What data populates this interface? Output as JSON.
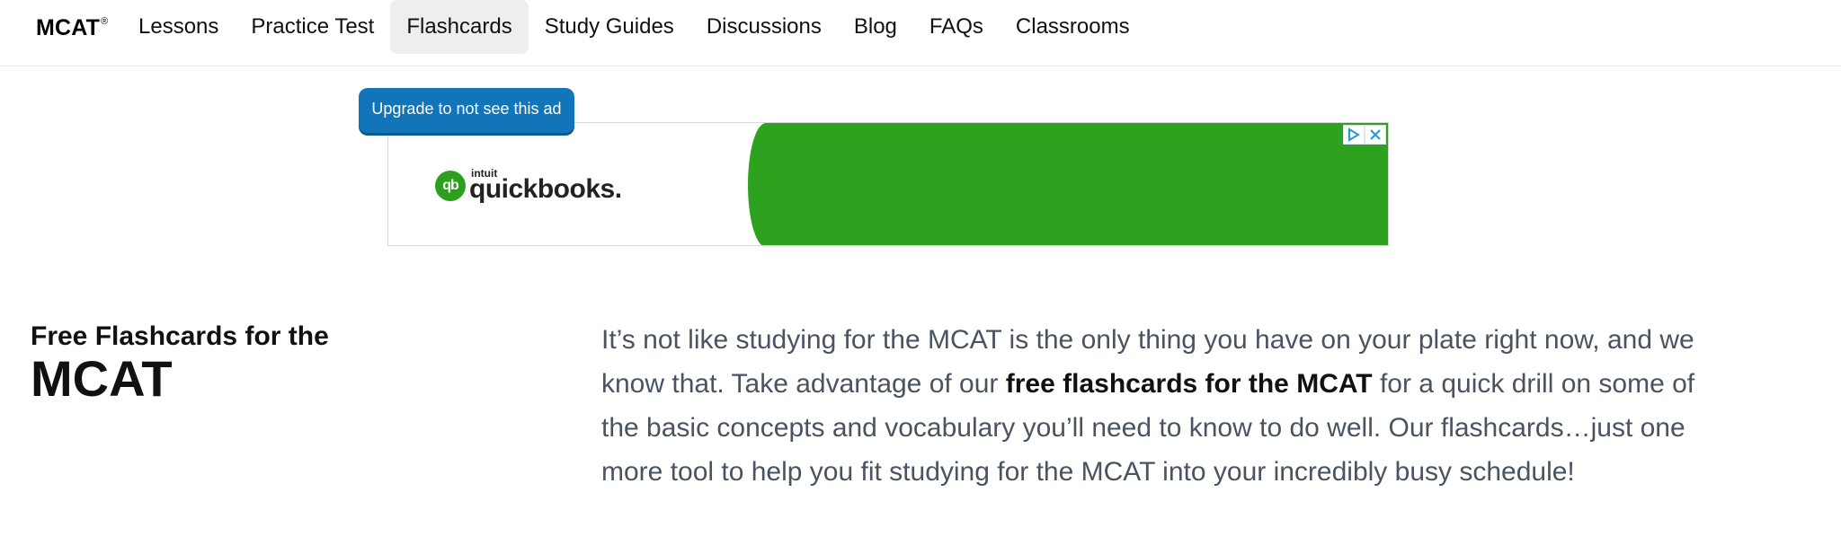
{
  "nav": {
    "brand": "MCAT",
    "brand_mark": "®",
    "items": [
      {
        "label": "Lessons"
      },
      {
        "label": "Practice Test"
      },
      {
        "label": "Flashcards",
        "active": true
      },
      {
        "label": "Study Guides"
      },
      {
        "label": "Discussions"
      },
      {
        "label": "Blog"
      },
      {
        "label": "FAQs"
      },
      {
        "label": "Classrooms"
      }
    ]
  },
  "ad": {
    "upgrade_label": "Upgrade to not see this ad",
    "logo_small": "intuit",
    "logo_name": "quickbooks.",
    "logo_mark": "qb",
    "icons": [
      "adchoices-icon",
      "close-icon"
    ],
    "accent_color": "#2ea11f"
  },
  "page": {
    "title_line1": "Free Flashcards for the",
    "title_line2": "MCAT",
    "intro_before": "It’s not like studying for the MCAT is the only thing you have on your plate right now, and we know that. Take advantage of our ",
    "intro_bold": "free flashcards for the MCAT",
    "intro_after": " for a quick drill on some of the basic concepts and vocabulary you’ll need to know to do well. Our flashcards…just one more tool to help you fit studying for the MCAT into your incredibly busy schedule!"
  },
  "colors": {
    "upgrade_button": "#1274b9",
    "nav_active_bg": "#eeeeee",
    "body_text": "#4a5360"
  }
}
